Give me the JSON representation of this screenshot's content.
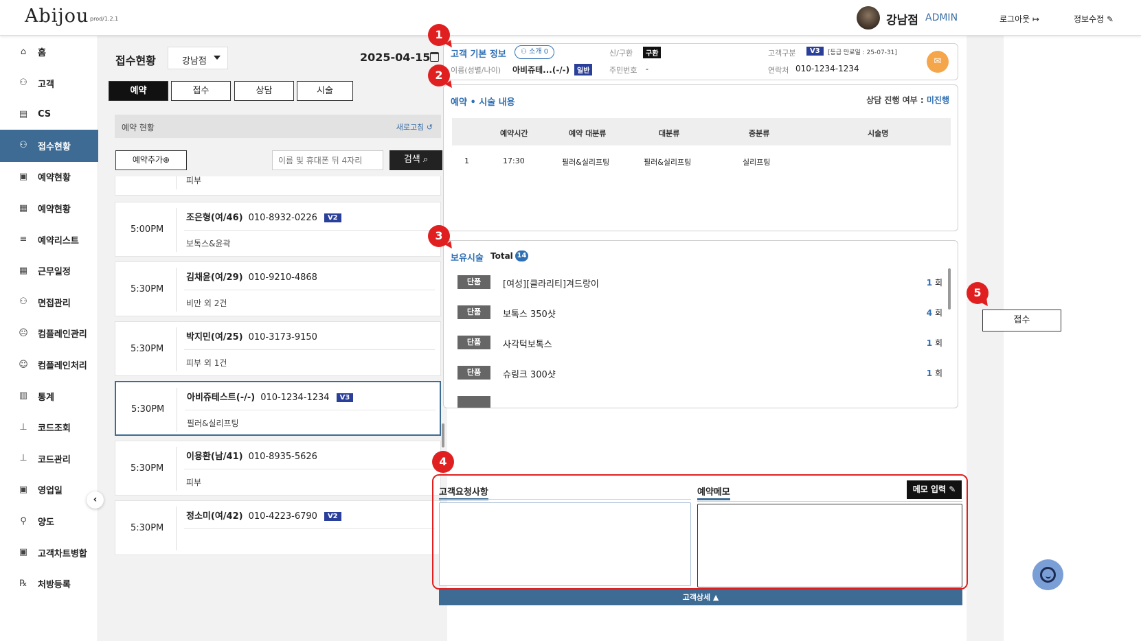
{
  "header": {
    "logo": "Abijou",
    "version": "prod/1.2.1",
    "store": "강남점",
    "role": "ADMIN",
    "logout": "로그아웃",
    "edit_info": "정보수정"
  },
  "sidebar": {
    "items": [
      {
        "label": "홈",
        "icon": "home-icon"
      },
      {
        "label": "고객",
        "icon": "users-icon"
      },
      {
        "label": "CS",
        "icon": "document-icon"
      },
      {
        "label": "접수현황",
        "icon": "reception-icon",
        "active": true
      },
      {
        "label": "예약현황",
        "icon": "calendar-icon"
      },
      {
        "label": "예약현황",
        "icon": "calendar-grid-icon"
      },
      {
        "label": "예약리스트",
        "icon": "list-icon"
      },
      {
        "label": "근무일정",
        "icon": "schedule-icon"
      },
      {
        "label": "면접관리",
        "icon": "interview-icon"
      },
      {
        "label": "컴플레인관리",
        "icon": "complaint-icon"
      },
      {
        "label": "컴플레인처리",
        "icon": "smile-icon"
      },
      {
        "label": "통계",
        "icon": "chart-icon"
      },
      {
        "label": "코드조회",
        "icon": "tree-icon"
      },
      {
        "label": "코드관리",
        "icon": "tree-manage-icon"
      },
      {
        "label": "영업일",
        "icon": "business-day-icon"
      },
      {
        "label": "양도",
        "icon": "transfer-icon"
      },
      {
        "label": "고객차트병합",
        "icon": "merge-icon"
      },
      {
        "label": "처방등록",
        "icon": "prescription-icon"
      }
    ],
    "collapse_glyph": "‹"
  },
  "reception": {
    "title": "접수현황",
    "branch": "강남점",
    "date": "2025-04-15",
    "tabs": [
      "예약",
      "접수",
      "상담",
      "시술"
    ],
    "active_tab": 0,
    "section_title": "예약 현황",
    "refresh": "새로고침",
    "add_button": "예약추가",
    "search_placeholder": "이름 및 휴대폰 뒤 4자리",
    "search_button": "검색",
    "list": [
      {
        "time": "",
        "name": "",
        "phone": "",
        "grade": "",
        "service": "피부"
      },
      {
        "time": "5:00PM",
        "name": "조은형(여/46)",
        "phone": "010-8932-0226",
        "grade": "V2",
        "service": "보톡스&윤곽"
      },
      {
        "time": "5:30PM",
        "name": "김채윤(여/29)",
        "phone": "010-9210-4868",
        "grade": "",
        "service": "비만 외 2건"
      },
      {
        "time": "5:30PM",
        "name": "박지민(여/25)",
        "phone": "010-3173-9150",
        "grade": "",
        "service": "피부 외 1건"
      },
      {
        "time": "5:30PM",
        "name": "아비쥬테스트(-/-)",
        "phone": "010-1234-1234",
        "grade": "V3",
        "service": "필러&실리프팅",
        "selected": true
      },
      {
        "time": "5:30PM",
        "name": "이용환(남/41)",
        "phone": "010-8935-5626",
        "grade": "",
        "service": "피부"
      },
      {
        "time": "5:30PM",
        "name": "정소미(여/42)",
        "phone": "010-4223-6790",
        "grade": "V2",
        "service": ""
      }
    ]
  },
  "customer": {
    "section_title": "고객 기본 정보",
    "referral": "소개 0",
    "type_label": "신/구환",
    "type_value": "구환",
    "class_label": "고객구분",
    "class_value": "V3",
    "class_note": "[등급 만료일 : 25-07-31]",
    "name_label": "이름(성별/나이)",
    "name_value": "아비쥬테...(-/-)",
    "name_badge": "일반",
    "rrn_label": "주민번호",
    "rrn_value": "-",
    "phone_label": "연락처",
    "phone_value": "010-1234-1234"
  },
  "booking": {
    "section_title": "예약 • 시술 내용",
    "consult_label": "상담 진행 여부 : ",
    "consult_value": "미진행",
    "columns": [
      "예약시간",
      "예약 대분류",
      "대분류",
      "중분류",
      "시술명"
    ],
    "rows": [
      {
        "no": "1",
        "time": "17:30",
        "res_cat": "필러&실리프팅",
        "major": "필러&실리프팅",
        "middle": "실리프팅",
        "name": ""
      }
    ]
  },
  "owned": {
    "section_title": "보유시술",
    "total_label": "Total",
    "total": "14",
    "count_suffix": "회",
    "items": [
      {
        "tag": "단품",
        "name": "[여성][클라리티]겨드랑이",
        "count": "1"
      },
      {
        "tag": "단품",
        "name": "보톡스 350샷",
        "count": "4"
      },
      {
        "tag": "단품",
        "name": "사각턱보톡스",
        "count": "1"
      },
      {
        "tag": "단품",
        "name": "슈링크 300샷",
        "count": "1"
      }
    ]
  },
  "memo": {
    "request_title": "고객요청사항",
    "memo_title": "예약메모",
    "memo_button": "메모 입력"
  },
  "footer": {
    "detail": "고객상세 ▲"
  },
  "actions": {
    "reception": "접수"
  },
  "annotations": [
    "1",
    "2",
    "3",
    "4",
    "5"
  ],
  "colors": {
    "accent": "#3d6b93",
    "highlight_red": "#e02020",
    "link_blue": "#2f6fb3",
    "grade_badge": "#2a3f9a"
  }
}
